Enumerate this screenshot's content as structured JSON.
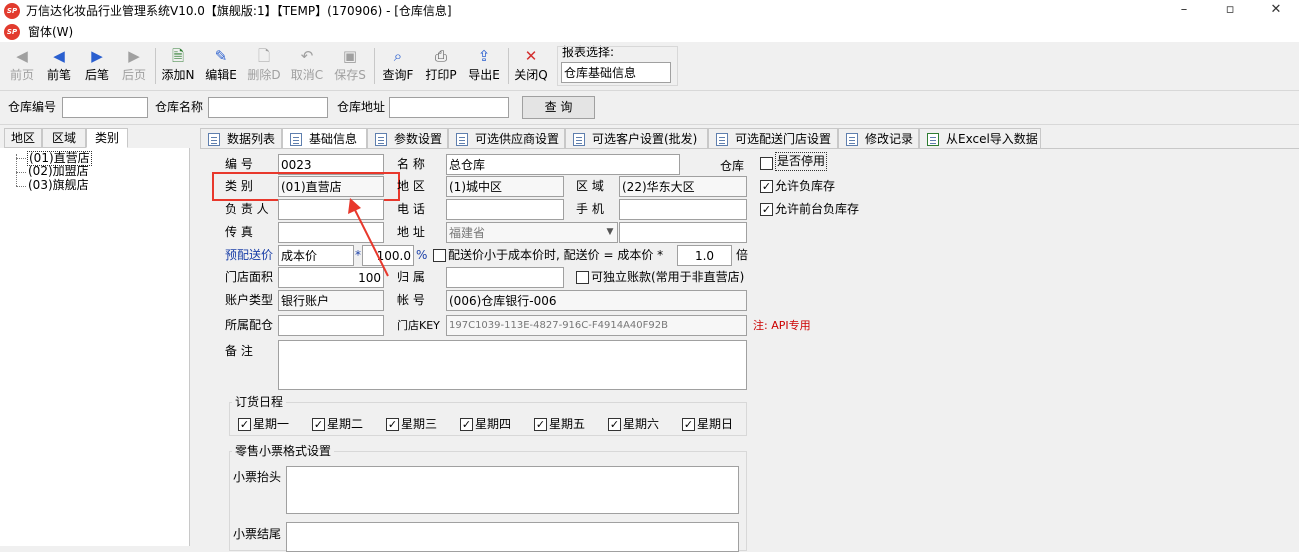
{
  "window": {
    "title": "万信达化妆品行业管理系统V10.0【旗舰版:1】【TEMP】(170906) - [仓库信息]",
    "controls": {
      "minimize": "–",
      "maximize": "▫",
      "close": "✕"
    }
  },
  "menu": {
    "window_label": "窗体(W)"
  },
  "toolbar": {
    "first": "前页",
    "prev": "前笔",
    "next": "后笔",
    "last": "后页",
    "add": "添加N",
    "edit": "编辑E",
    "delete": "删除D",
    "cancel": "取消C",
    "save": "保存S",
    "query": "查询F",
    "print": "打印P",
    "export": "导出E",
    "close": "关闭Q",
    "report_label": "报表选择:",
    "report_value": "仓库基础信息"
  },
  "search": {
    "code_label": "仓库编号",
    "code_value": "",
    "name_label": "仓库名称",
    "name_value": "",
    "addr_label": "仓库地址",
    "addr_value": "",
    "query_button": "查  询"
  },
  "left_tabs": [
    "地区",
    "区域",
    "类别"
  ],
  "tree": [
    "(01)直营店",
    "(02)加盟店",
    "(03)旗舰店"
  ],
  "tabs": [
    "数据列表",
    "基础信息",
    "参数设置",
    "可选供应商设置",
    "可选客户设置(批发)",
    "可选配送门店设置",
    "修改记录",
    "从Excel导入数据"
  ],
  "form": {
    "code_label": "编    号",
    "code": "0023",
    "name_label": "名    称",
    "name": "总仓库",
    "name_suffix": "仓库",
    "disabled_label": "是否停用",
    "type_label": "类    别",
    "type": "(01)直营店",
    "region_label": "地  区",
    "region": "(1)城中区",
    "area_label": "区  域",
    "area": "(22)华东大区",
    "neg_stock_label": "允许负库存",
    "owner_label": "负 责 人",
    "owner": "",
    "phone_label": "电  话",
    "phone": "",
    "mobile_label": "手  机",
    "mobile": "",
    "front_neg_label": "允许前台负库存",
    "fax_label": "传    真",
    "fax": "",
    "addr_label": "地  址",
    "addr": "福建省",
    "addr_extra": "",
    "price_label": "预配送价",
    "price_type": "成本价",
    "price_star": "*",
    "price_pct": "100.0",
    "pct_sign": "%",
    "below_cost_label": "配送价小于成本价时, 配送价 = 成本价 *",
    "below_cost_factor": "1.0",
    "below_cost_unit": "倍",
    "area_size_label": "门店面积",
    "area_size": "100",
    "belong_label": "归  属",
    "belong": "",
    "indep_label": "可独立账款(常用于非直营店)",
    "acct_type_label": "账户类型",
    "acct_type": "银行账户",
    "acct_no_label": "帐  号",
    "acct_no": "(006)仓库银行-006",
    "dist_label": "所属配仓",
    "dist": "",
    "key_label": "门店KEY",
    "key": "197C1039-113E-4827-916C-F4914A40F92B",
    "key_note": "注: API专用",
    "remark_label": "备    注",
    "remark": ""
  },
  "order_days": {
    "title": "订货日程",
    "days": [
      "星期一",
      "星期二",
      "星期三",
      "星期四",
      "星期五",
      "星期六",
      "星期日"
    ]
  },
  "receipt": {
    "title": "零售小票格式设置",
    "header_label": "小票抬头",
    "footer_label": "小票结尾"
  },
  "colors": {
    "highlight": "#e8382c",
    "note": "#cc0000",
    "blue_label": "#1a3fa8"
  }
}
